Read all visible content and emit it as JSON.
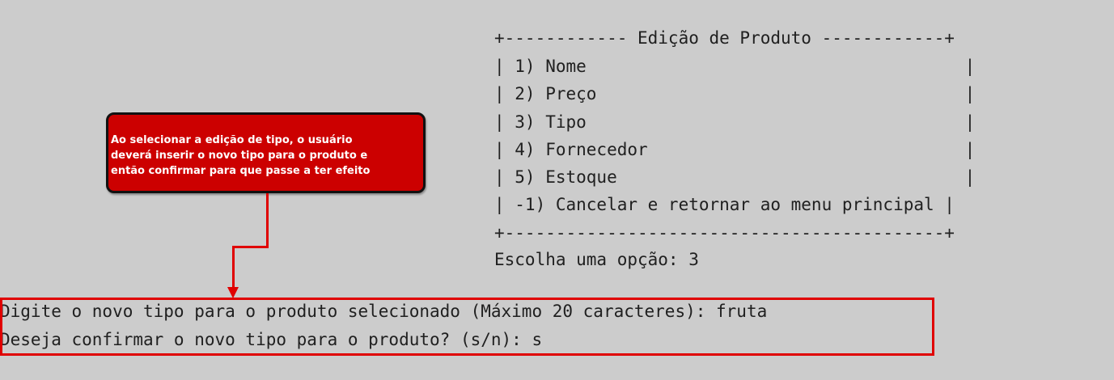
{
  "menu": {
    "border_top": "+------------ Edição de Produto ------------+",
    "items": [
      "| 1) Nome                                     |",
      "| 2) Preço                                    |",
      "| 3) Tipo                                     |",
      "| 4) Fornecedor                               |",
      "| 5) Estoque                                  |",
      "| -1) Cancelar e retornar ao menu principal |"
    ],
    "border_bottom": "+-------------------------------------------+",
    "prompt": "Escolha uma opção: 3"
  },
  "session": {
    "line1": "Digite o novo tipo para o produto selecionado (Máximo 20 caracteres): fruta",
    "line2": "Deseja confirmar o novo tipo para o produto? (s/n): s"
  },
  "callout": {
    "lines": [
      "Ao selecionar a edição de tipo, o usuário",
      "deverá inserir o novo tipo para o produto e",
      "então confirmar para que passe a ter efeito"
    ]
  },
  "colors": {
    "background": "#cccccc",
    "terminal_text": "#202020",
    "annotation_red": "#e00000",
    "callout_fill": "#cc0000"
  }
}
